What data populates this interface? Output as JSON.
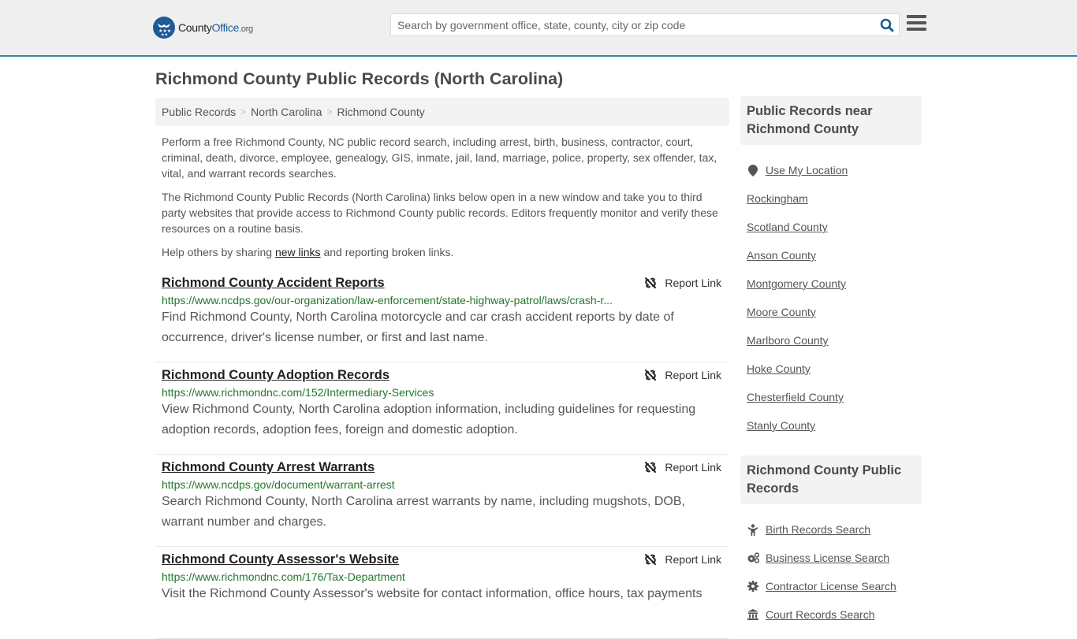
{
  "header": {
    "logo": {
      "name": "County",
      "name_accent": "Office",
      "tld": ".org"
    },
    "search": {
      "placeholder": "Search by government office, state, county, city or zip code",
      "value": ""
    },
    "colors": {
      "brand": "#1f5a96",
      "header_border": "#3d7eac",
      "url_green": "#23772b"
    }
  },
  "page": {
    "title": "Richmond County Public Records (North Carolina)",
    "breadcrumb": [
      "Public Records",
      "North Carolina",
      "Richmond County"
    ],
    "intro": {
      "p1": "Perform a free Richmond County, NC public record search, including arrest, birth, business, contractor, court, criminal, death, divorce, employee, genealogy, GIS, inmate, jail, land, marriage, police, property, sex offender, tax, vital, and warrant records searches.",
      "p2": "The Richmond County Public Records (North Carolina) links below open in a new window and take you to third party websites that provide access to Richmond County public records. Editors frequently monitor and verify these resources on a routine basis.",
      "p3_before": "Help others by sharing ",
      "p3_link": "new links",
      "p3_after": " and reporting broken links."
    }
  },
  "records": [
    {
      "title": "Richmond County Accident Reports",
      "url": "https://www.ncdps.gov/our-organization/law-enforcement/state-highway-patrol/laws/crash-r...",
      "description": "Find Richmond County, North Carolina motorcycle and car crash accident reports by date of occurrence, driver's license number, or first and last name.",
      "report_label": "Report Link"
    },
    {
      "title": "Richmond County Adoption Records",
      "url": "https://www.richmondnc.com/152/Intermediary-Services",
      "description": "View Richmond County, North Carolina adoption information, including guidelines for requesting adoption records, adoption fees, foreign and domestic adoption.",
      "report_label": "Report Link"
    },
    {
      "title": "Richmond County Arrest Warrants",
      "url": "https://www.ncdps.gov/document/warrant-arrest",
      "description": "Search Richmond County, North Carolina arrest warrants by name, including mugshots, DOB, warrant number and charges.",
      "report_label": "Report Link"
    },
    {
      "title": "Richmond County Assessor's Website",
      "url": "https://www.richmondnc.com/176/Tax-Department",
      "description": "Visit the Richmond County Assessor's website for contact information, office hours, tax payments",
      "report_label": "Report Link"
    }
  ],
  "sidebar": {
    "nearby": {
      "heading": "Public Records near Richmond County",
      "use_location": "Use My Location",
      "items": [
        "Rockingham",
        "Scotland County",
        "Anson County",
        "Montgomery County",
        "Moore County",
        "Marlboro County",
        "Hoke County",
        "Chesterfield County",
        "Stanly County"
      ]
    },
    "county_records": {
      "heading": "Richmond County Public Records",
      "items": [
        {
          "label": "Birth Records Search",
          "icon": "child-icon"
        },
        {
          "label": "Business License Search",
          "icon": "cogs-icon"
        },
        {
          "label": "Contractor License Search",
          "icon": "gear-icon"
        },
        {
          "label": "Court Records Search",
          "icon": "courthouse-icon"
        }
      ]
    }
  }
}
